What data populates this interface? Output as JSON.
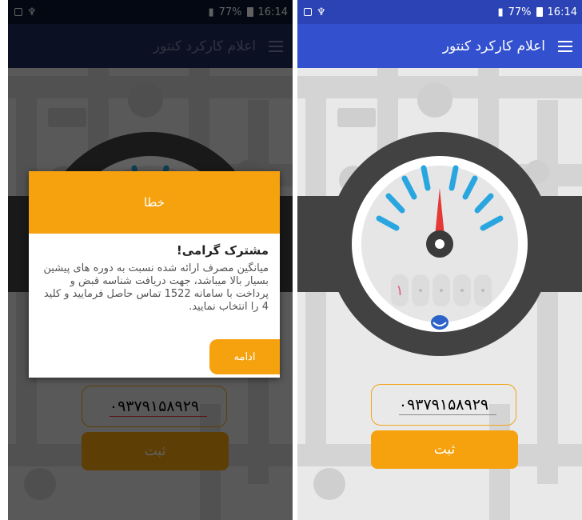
{
  "status": {
    "time": "16:14",
    "battery": "77%"
  },
  "appbar": {
    "title": "اعلام کارکرد کنتور"
  },
  "meter": {
    "digit_value": "۱"
  },
  "phone": {
    "value": "۰۹۳۷۹۱۵۸۹۲۹"
  },
  "submit": {
    "label": "ثبت"
  },
  "dialog": {
    "header": "خطا",
    "title": "مشترک گرامی!",
    "message": "میانگین مصرف ارائه شده نسبت به دوره های پیشین بسیار بالا میباشد، جهت دریافت شناسه قبض و پرداخت با سامانه 1522 تماس حاصل فرمایید و کلید 4 را انتخاب نمایید.",
    "button": "ادامه"
  },
  "colors": {
    "primary": "#3350cf",
    "accent": "#f5a20e",
    "needle": "#e53935",
    "ticks": "#29a6e0"
  }
}
